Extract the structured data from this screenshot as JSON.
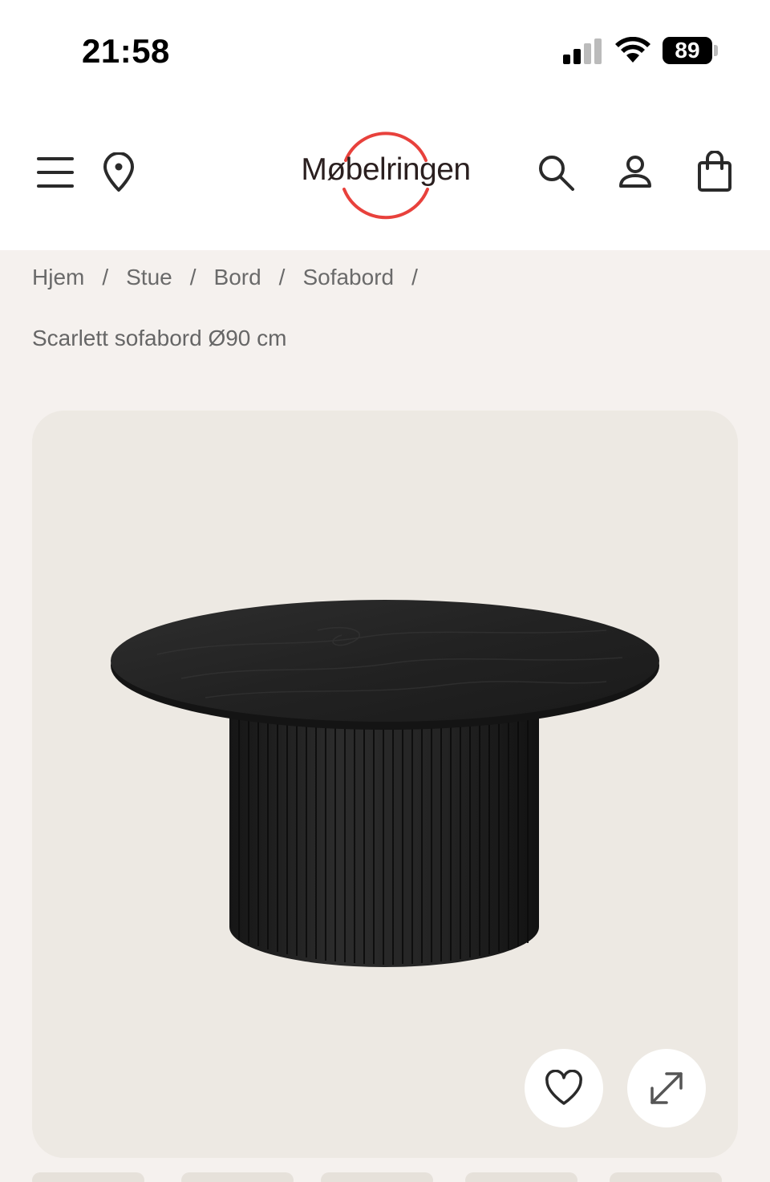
{
  "status_bar": {
    "time": "21:58",
    "battery": "89"
  },
  "header": {
    "logo": "Møbelringen",
    "brand_color": "#e8413c",
    "icons": [
      "menu-icon",
      "location-pin-icon",
      "search-icon",
      "user-icon",
      "shopping-bag-icon"
    ]
  },
  "breadcrumb": {
    "items": [
      "Hjem",
      "Stue",
      "Bord",
      "Sofabord"
    ],
    "separator": "/"
  },
  "product": {
    "title": "Scarlett sofabord Ø90 cm",
    "image_alt_icon": "table-image",
    "actions": [
      "heart-icon",
      "expand-icon"
    ]
  }
}
